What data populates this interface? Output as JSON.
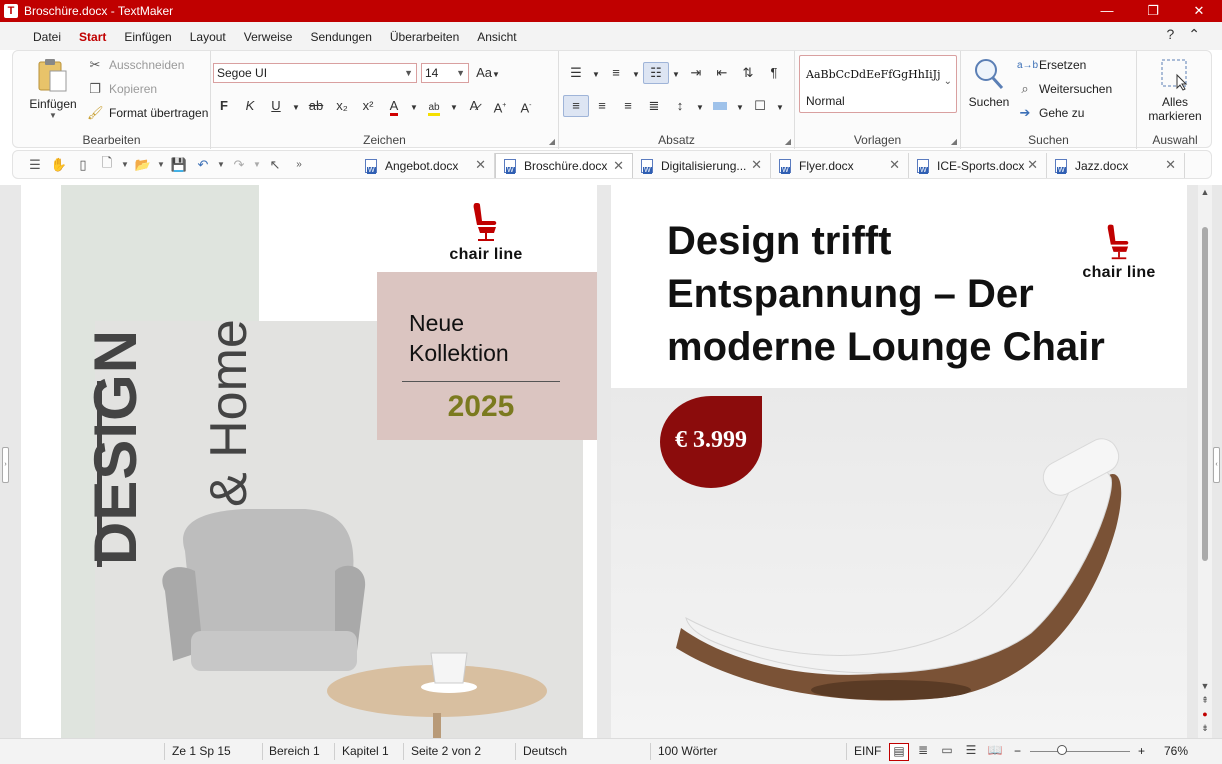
{
  "window": {
    "app_badge": "T",
    "title": "Broschüre.docx - TextMaker",
    "minimize": "—",
    "maximize": "❐",
    "close": "✕"
  },
  "menu": {
    "tabs": [
      "Datei",
      "Start",
      "Einfügen",
      "Layout",
      "Verweise",
      "Sendungen",
      "Überarbeiten",
      "Ansicht"
    ],
    "active": "Start",
    "help": "?",
    "collapse": "⌃"
  },
  "ribbon": {
    "bearbeiten": {
      "label": "Bearbeiten",
      "paste": "Einfügen",
      "cut": "Ausschneiden",
      "copy": "Kopieren",
      "format_painter": "Format übertragen"
    },
    "zeichen": {
      "label": "Zeichen",
      "font": "Segoe UI",
      "size": "14",
      "bold": "F",
      "italic": "K",
      "underline": "U"
    },
    "absatz": {
      "label": "Absatz"
    },
    "vorlagen": {
      "label": "Vorlagen",
      "preview": "AaBbCcDdEeFfGgHhIiJj",
      "style_name": "Normal"
    },
    "suchen": {
      "label": "Suchen",
      "search": "Suchen",
      "replace": "Ersetzen",
      "find_next": "Weitersuchen",
      "goto": "Gehe zu"
    },
    "auswahl": {
      "label": "Auswahl",
      "select_all": "Alles markieren"
    }
  },
  "doc_tabs": [
    {
      "name": "Angebot.docx",
      "active": false
    },
    {
      "name": "Broschüre.docx",
      "active": true
    },
    {
      "name": "Digitalisierung...",
      "active": false
    },
    {
      "name": "Flyer.docx",
      "active": false
    },
    {
      "name": "ICE-Sports.docx",
      "active": false
    },
    {
      "name": "Jazz.docx",
      "active": false
    }
  ],
  "page1": {
    "logo": "chair line",
    "design_word": "DESIGN",
    "home_word": "& Home",
    "kollektion_line1": "Neue",
    "kollektion_line2": "Kollektion",
    "year": "2025"
  },
  "page2": {
    "title_line1": "Design trifft",
    "title_line2": "Entspannung – Der",
    "title_line3": "moderne Lounge Chair",
    "logo": "chair line",
    "price": "€ 3.999"
  },
  "status": {
    "position": "Ze 1 Sp 15",
    "area": "Bereich 1",
    "chapter": "Kapitel 1",
    "page": "Seite 2 von 2",
    "language": "Deutsch",
    "words": "100 Wörter",
    "mode": "EINF",
    "zoom": "76%"
  },
  "colors": {
    "brand": "#c00000",
    "price_badge": "#8b0c0c",
    "year": "#7b7a1f"
  }
}
